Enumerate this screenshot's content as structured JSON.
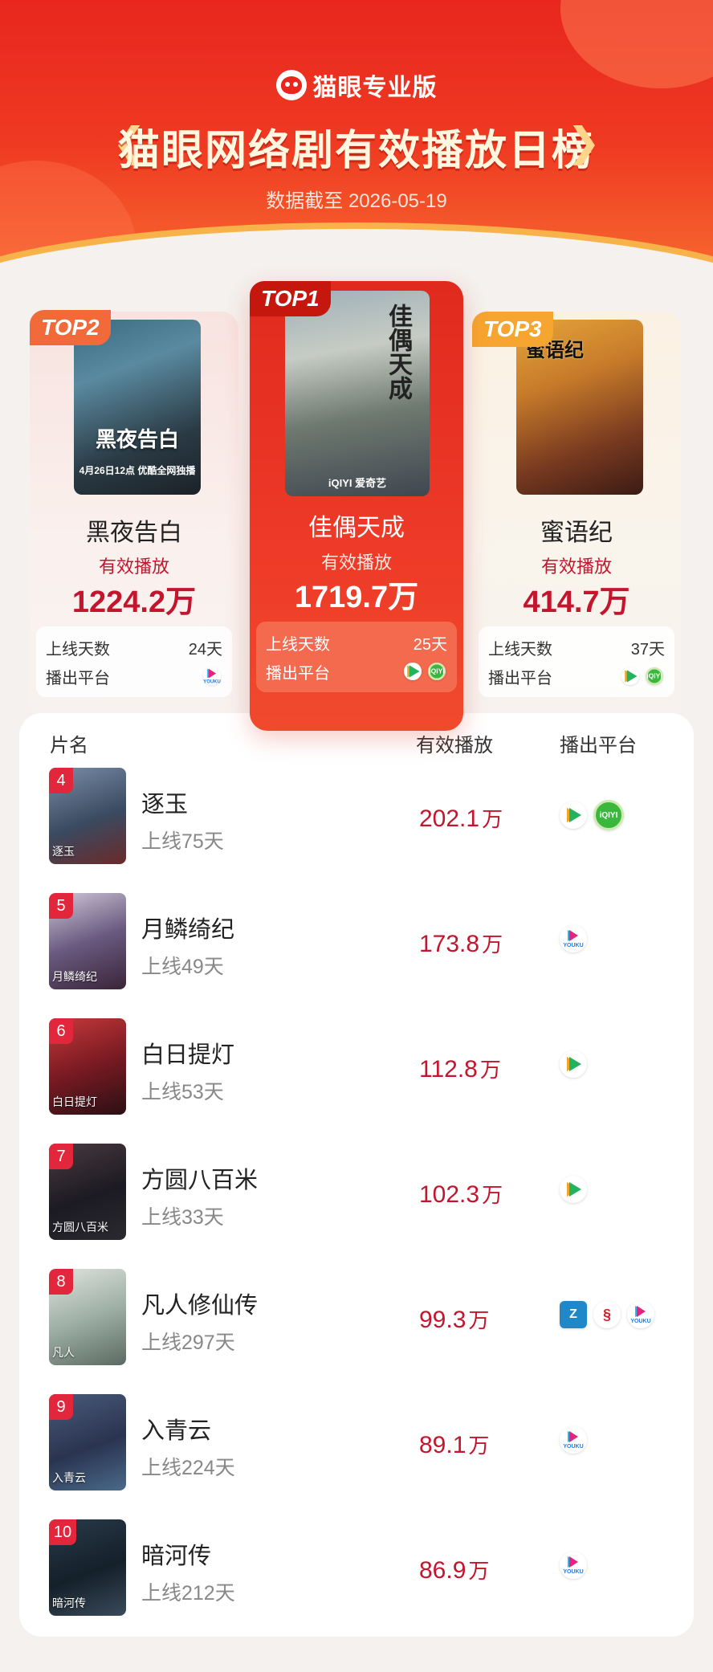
{
  "header": {
    "brand": "猫眼专业版",
    "title": "猫眼网络剧有效播放日榜",
    "date_line": "数据截至 2026-05-19"
  },
  "labels": {
    "valid_play": "有效播放",
    "days_online": "上线天数",
    "platform": "播出平台"
  },
  "top3": [
    {
      "rank_tag": "TOP2",
      "name": "黑夜告白",
      "value": "1224.2万",
      "days": "24天",
      "poster_title": "黑夜告白",
      "poster_sub": "4月26日12点 优酷全网独播",
      "platform_icons": [
        "youku-icon"
      ]
    },
    {
      "rank_tag": "TOP1",
      "name": "佳偶天成",
      "value": "1719.7万",
      "days": "25天",
      "poster_title": "佳偶天成",
      "poster_badge": "iQIYI 爱奇艺",
      "platform_icons": [
        "tencent-video-icon",
        "iqiyi-icon"
      ]
    },
    {
      "rank_tag": "TOP3",
      "name": "蜜语纪",
      "value": "414.7万",
      "days": "37天",
      "poster_title": "蜜语纪",
      "platform_icons": [
        "tencent-video-icon",
        "iqiyi-icon"
      ]
    }
  ],
  "table": {
    "headers": {
      "name": "片名",
      "play": "有效播放",
      "platform": "播出平台"
    },
    "rows": [
      {
        "rank": "4",
        "name": "逐玉",
        "days": "上线75天",
        "value": "202.1",
        "unit": "万",
        "platforms": [
          "tencent-video-icon",
          "iqiyi-icon"
        ],
        "thumb_text": "逐玉"
      },
      {
        "rank": "5",
        "name": "月鳞绮纪",
        "days": "上线49天",
        "value": "173.8",
        "unit": "万",
        "platforms": [
          "youku-icon"
        ],
        "thumb_text": "月鳞绮纪"
      },
      {
        "rank": "6",
        "name": "白日提灯",
        "days": "上线53天",
        "value": "112.8",
        "unit": "万",
        "platforms": [
          "tencent-video-icon"
        ],
        "thumb_text": "白日提灯"
      },
      {
        "rank": "7",
        "name": "方圆八百米",
        "days": "上线33天",
        "value": "102.3",
        "unit": "万",
        "platforms": [
          "tencent-video-icon"
        ],
        "thumb_text": "方圆八百米"
      },
      {
        "rank": "8",
        "name": "凡人修仙传",
        "days": "上线297天",
        "value": "99.3",
        "unit": "万",
        "platforms": [
          "zhejiang-tv-icon",
          "dragon-tv-icon",
          "youku-icon"
        ],
        "thumb_text": "凡人"
      },
      {
        "rank": "9",
        "name": "入青云",
        "days": "上线224天",
        "value": "89.1",
        "unit": "万",
        "platforms": [
          "youku-icon"
        ],
        "thumb_text": "入青云"
      },
      {
        "rank": "10",
        "name": "暗河传",
        "days": "上线212天",
        "value": "86.9",
        "unit": "万",
        "platforms": [
          "youku-icon"
        ],
        "thumb_text": "暗河传"
      }
    ]
  },
  "colors": {
    "header_red": "#e8261e",
    "accent_red": "#c4152e",
    "rank_badge": "#e2263b",
    "top2_tag": "#f26a3a",
    "top3_tag": "#f6a531"
  }
}
